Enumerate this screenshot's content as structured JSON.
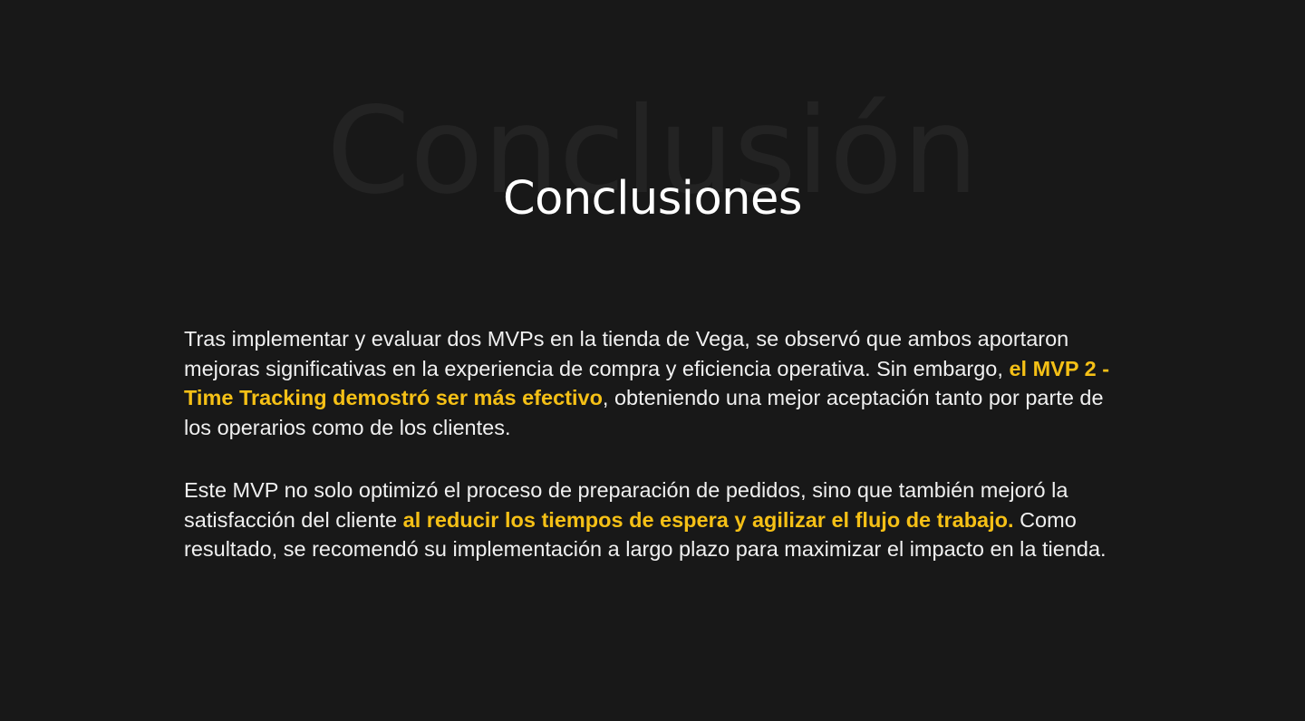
{
  "section": {
    "watermark": "Conclusión",
    "title": "Conclusiones"
  },
  "paragraphs": [
    {
      "before": "Tras implementar y evaluar dos MVPs en la tienda de Vega, se observó que ambos aportaron mejoras significativas en la experiencia de compra y eficiencia operativa. Sin embargo, ",
      "highlight": "el MVP 2 - Time Tracking demostró ser más efectivo",
      "after": ", obteniendo una mejor aceptación tanto por parte de los operarios como de los clientes."
    },
    {
      "before": "Este MVP no solo optimizó el proceso de preparación de pedidos, sino que también mejoró la satisfacción del cliente ",
      "highlight": "al reducir los tiempos de espera y agilizar el flujo de trabajo.",
      "after": " Como resultado, se recomendó su implementación a largo plazo para maximizar el impacto en la tienda."
    }
  ],
  "colors": {
    "background": "#181818",
    "text": "#f0f0f0",
    "accent": "#f5c016",
    "watermark": "#232323"
  }
}
